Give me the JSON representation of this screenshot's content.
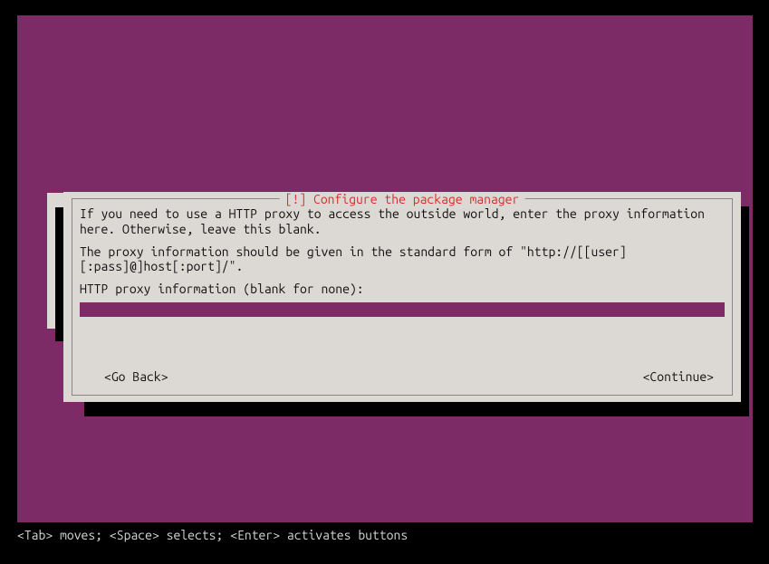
{
  "dialog": {
    "title": "[!] Configure the package manager",
    "para1": "If you need to use a HTTP proxy to access the outside world, enter the proxy information here. Otherwise, leave this blank.",
    "para2": "The proxy information should be given in the standard form of \"http://[[user][:pass]@]host[:port]/\".",
    "prompt": "HTTP proxy information (blank for none):",
    "input_value": "",
    "go_back_label": "<Go Back>",
    "continue_label": "<Continue>"
  },
  "help_bar": "<Tab> moves; <Space> selects; <Enter> activates buttons",
  "colors": {
    "background": "#7c2b67",
    "dialog_bg": "#dcd9d5",
    "title_color": "#d62f2f"
  }
}
